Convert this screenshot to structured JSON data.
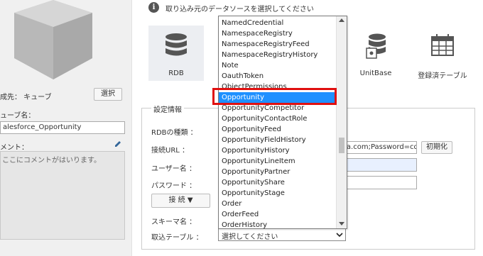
{
  "left_panel": {
    "dest_label": "成先： キューブ",
    "select_button": "選択",
    "cube_name_label": "ューブ名：",
    "cube_name_value": "alesforce_Opportunity",
    "comment_label": "メント：",
    "comment_text": "ここにコメントがはいります。"
  },
  "main": {
    "hint": "取り込み元のデータソースを選択してください",
    "sources": [
      {
        "label": "RDB",
        "icon": "database-icon",
        "selected": true
      },
      {
        "label": "UnitBase",
        "icon": "unitbase-icon",
        "selected": false
      },
      {
        "label": "登録済テーブル",
        "icon": "calendar-table-icon",
        "selected": false
      }
    ],
    "settings": {
      "legend": "設定情報",
      "rdb_type_label": "RDBの種類 ：",
      "url_label": "接続URL ：",
      "url_value": "ta.com;Password=cd",
      "init_button": "初期化",
      "user_label": "ユーザー名 ：",
      "password_label": "パスワード ：",
      "connect_button": "接 続 ▼",
      "schema_label": "スキーマ名 ：",
      "import_table_label": "取込テーブル ：",
      "import_table_value": "選択してください"
    }
  },
  "dropdown": {
    "highlighted": "Opportunity",
    "items": [
      "NamedCredential",
      "NamespaceRegistry",
      "NamespaceRegistryFeed",
      "NamespaceRegistryHistory",
      "Note",
      "OauthToken",
      "ObjectPermissions",
      "Opportunity",
      "OpportunityCompetitor",
      "OpportunityContactRole",
      "OpportunityFeed",
      "OpportunityFieldHistory",
      "OpportunityHistory",
      "OpportunityLineItem",
      "OpportunityPartner",
      "OpportunityShare",
      "OpportunityStage",
      "Order",
      "OrderFeed",
      "OrderHistory"
    ]
  },
  "colors": {
    "highlight": "#1e90ff",
    "annotation": "#e01010"
  }
}
